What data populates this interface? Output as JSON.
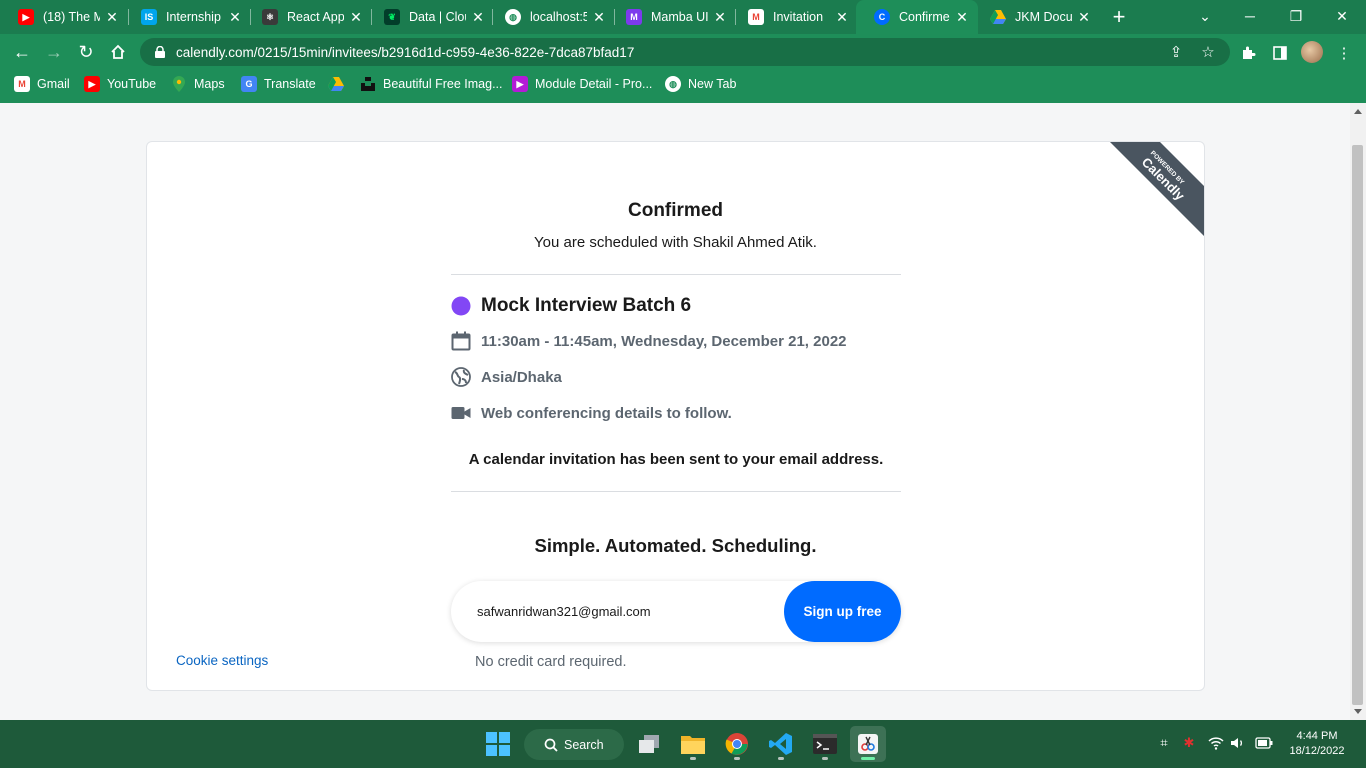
{
  "browser": {
    "tabs": [
      {
        "label": "(18) The M",
        "icon": "youtube-icon",
        "color": "#ff0000"
      },
      {
        "label": "Internship",
        "icon": "internshala-icon",
        "color": "#00a5ec"
      },
      {
        "label": "React App",
        "icon": "react-app-icon",
        "color": "#3a3a3a"
      },
      {
        "label": "Data | Clou",
        "icon": "mongodb-leaf-icon",
        "color": "#00ed64"
      },
      {
        "label": "localhost:5",
        "icon": "globe-icon",
        "color": "#ffffff"
      },
      {
        "label": "Mamba UI",
        "icon": "mamba-ui-icon",
        "color": "#7c3aed"
      },
      {
        "label": "Invitation",
        "icon": "gmail-icon",
        "color": "#ea4335"
      },
      {
        "label": "Confirmed",
        "icon": "calendly-icon",
        "color": "#006bff",
        "active": true
      },
      {
        "label": "JKM Docu",
        "icon": "google-drive-icon",
        "color": "#fbbc04"
      }
    ],
    "url": "calendly.com/0215/15min/invitees/b2916d1d-c959-4e36-822e-7dca87bfad17",
    "bookmarks": [
      {
        "label": "Gmail",
        "icon": "gmail-icon"
      },
      {
        "label": "YouTube",
        "icon": "youtube-icon"
      },
      {
        "label": "Maps",
        "icon": "google-maps-icon"
      },
      {
        "label": "Translate",
        "icon": "google-translate-icon"
      },
      {
        "label": "",
        "icon": "google-drive-icon"
      },
      {
        "label": "Beautiful Free Imag...",
        "icon": "unsplash-icon"
      },
      {
        "label": "Module Detail - Pro...",
        "icon": "module-icon"
      },
      {
        "label": "New Tab",
        "icon": "globe-icon"
      }
    ],
    "theme_color": "#1e8e59"
  },
  "page": {
    "ribbon_line1": "POWERED BY",
    "ribbon_line2": "Calendly",
    "title": "Confirmed",
    "subtitle": "You are scheduled with Shakil Ahmed Atik.",
    "event_name": "Mock Interview Batch 6",
    "event_color": "#8247f5",
    "time": "11:30am - 11:45am, Wednesday, December 21, 2022",
    "timezone": "Asia/Dhaka",
    "conferencing": "Web conferencing details to follow.",
    "notice": "A calendar invitation has been sent to your email address.",
    "tagline": "Simple. Automated. Scheduling.",
    "email_value": "safwanridwan321@gmail.com",
    "signup_button": "Sign up free",
    "no_credit": "No credit card required.",
    "cookie_settings": "Cookie settings",
    "accent_color": "#006bff"
  },
  "taskbar": {
    "search_label": "Search",
    "time": "4:44 PM",
    "date": "18/12/2022"
  }
}
